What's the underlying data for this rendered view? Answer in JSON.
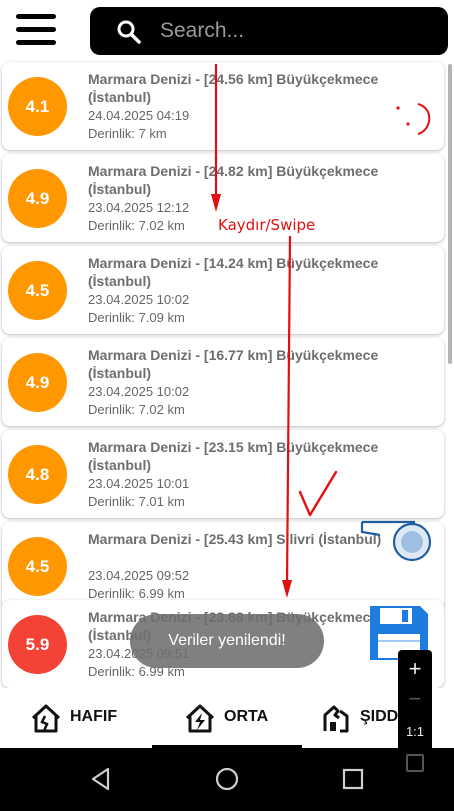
{
  "search": {
    "placeholder": "Search..."
  },
  "quakes": [
    {
      "magnitude": "4.1",
      "title": "Marmara Denizi - [24.56 km] Büyükçekmece (İstanbul)",
      "date": "24.04.2025 04:19",
      "depth": "Derinlik: 7 km",
      "color": "#ff9800"
    },
    {
      "magnitude": "4.9",
      "title": "Marmara Denizi - [24.82 km] Büyükçekmece (İstanbul)",
      "date": "23.04.2025 12:12",
      "depth": "Derinlik: 7.02 km",
      "color": "#ff9800"
    },
    {
      "magnitude": "4.5",
      "title": "Marmara Denizi - [14.24 km] Büyükçekmece (İstanbul)",
      "date": "23.04.2025 10:02",
      "depth": "Derinlik: 7.09 km",
      "color": "#ff9800"
    },
    {
      "magnitude": "4.9",
      "title": "Marmara Denizi - [16.77 km] Büyükçekmece (İstanbul)",
      "date": "23.04.2025 10:02",
      "depth": "Derinlik: 7.02 km",
      "color": "#ff9800"
    },
    {
      "magnitude": "4.8",
      "title": "Marmara Denizi - [23.15 km] Büyükçekmece (İstanbul)",
      "date": "23.04.2025 10:01",
      "depth": "Derinlik: 7.01 km",
      "color": "#ff9800"
    },
    {
      "magnitude": "4.5",
      "title": "Marmara Denizi - [25.43 km] Silivri (İstanbul)",
      "date": "23.04.2025 09:52",
      "depth": "Derinlik: 6.99 km",
      "color": "#ff9800"
    },
    {
      "magnitude": "5.9",
      "title": "Marmara Denizi - [23.88 km] Büyükçekmece (İstanbul)",
      "date": "23.04.2025 09:51",
      "depth": "Derinlik: 6.99 km",
      "color": "#f44336"
    }
  ],
  "annotation": {
    "swipe_label": "Kaydır/Swipe"
  },
  "toast": {
    "message": "Veriler yenilendi!"
  },
  "zoom": {
    "zoom_in": "+",
    "zoom_out": "−",
    "ratio": "1:1"
  },
  "tabs": {
    "hafif": "HAFIF",
    "orta": "ORTA",
    "siddetli": "ŞIDDETLI",
    "selected": "orta"
  },
  "colors": {
    "orange": "#ff9800",
    "red": "#f44336",
    "annotation_red": "#e01010",
    "whistle_blue": "#1f5f9f",
    "save_blue": "#1e7be0"
  }
}
